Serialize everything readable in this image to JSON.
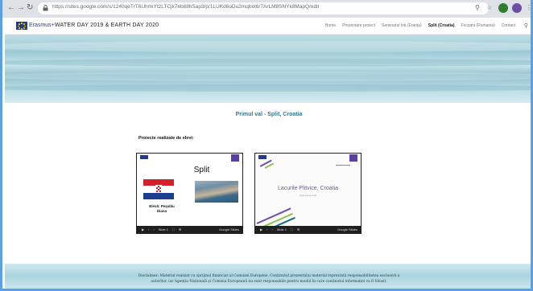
{
  "browser": {
    "url": "https://sites.google.com/s/1240qeTrT6UhmiYt2LTCjk7eb88hSap3/p/1LUKd6oDu2mqbot6/7ArLM8SNYk8MapQ/edit"
  },
  "site": {
    "logo_text": "Erasmus+",
    "title": "WATER DAY 2019 & EARTH DAY 2020",
    "nav": [
      {
        "label": "Home",
        "active": false
      },
      {
        "label": "Prezentare proiect",
        "active": false
      },
      {
        "label": "Seminarul Iniț (Franța)",
        "active": false
      },
      {
        "label": "Split (Croatia)",
        "active": true
      },
      {
        "label": "Focșani (Romania)",
        "active": false
      },
      {
        "label": "Contact",
        "active": false
      }
    ]
  },
  "main": {
    "wave_title": "Primul val - Split, Croatia",
    "projects_heading": "Proiecte realizate de elevi:",
    "slide1": {
      "title": "Split",
      "caption_line1": "Elevă: Peșalău",
      "caption_line2": "Diana",
      "controls_slide": "Slide 1",
      "controls_brand": "Google Slides"
    },
    "slide2": {
      "title": "Lacurile Plitvice, Croatia",
      "subtitle": "Oană Georgi Anisă",
      "controls_slide": "Slide 1",
      "controls_brand": "Google Slides"
    }
  },
  "footer": {
    "disclaimer": "Disclaimer: Material realizat cu sprijinul financiar al Comisiei Europene. Conținutul prezentului material reprezintă responsabilitatea exclusivă a autorilor, iar Agenția Națională și Comisia Europeană nu sunt responsabile pentru modul în care conținutul informației va fi folosit."
  },
  "colors": {
    "accent": "#2b7a91",
    "browser_border": "#5aa0e6",
    "eu_blue": "#1d3c8f"
  }
}
